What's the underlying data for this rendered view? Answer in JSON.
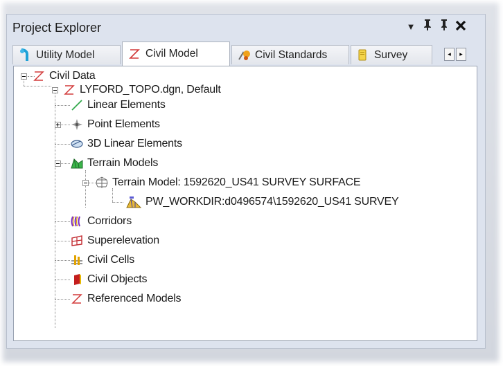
{
  "panel": {
    "title": "Project Explorer",
    "controls": {
      "dropdown": "▼",
      "pin": "ᵽ",
      "autohide": "ᵽ",
      "close": "✕"
    }
  },
  "tabs": [
    {
      "label": "Utility Model",
      "icon": "utility-model-icon",
      "active": false
    },
    {
      "label": "Civil Model",
      "icon": "civil-model-icon",
      "active": true
    },
    {
      "label": "Civil Standards",
      "icon": "civil-standards-icon",
      "active": false
    },
    {
      "label": "Survey",
      "icon": "survey-icon",
      "active": false
    }
  ],
  "tab_scroll": {
    "left": "◂",
    "right": "▸"
  },
  "tree": {
    "root": {
      "label": "Civil Data",
      "icon": "civil-data-icon"
    },
    "file": {
      "label": "LYFORD_TOPO.dgn, Default",
      "icon": "civil-data-icon"
    },
    "items": [
      {
        "label": "Linear Elements",
        "icon": "linear-elements-icon"
      },
      {
        "label": "Point Elements",
        "icon": "point-elements-icon"
      },
      {
        "label": "3D Linear Elements",
        "icon": "3d-linear-elements-icon"
      },
      {
        "label": "Terrain Models",
        "icon": "terrain-models-icon"
      },
      {
        "label": "Terrain Model: 1592620_US41 SURVEY SURFACE",
        "icon": "terrain-model-icon"
      },
      {
        "label": "PW_WORKDIR:d0496574\\1592620_US41 SURVEY",
        "icon": "survey-source-icon"
      },
      {
        "label": "Corridors",
        "icon": "corridors-icon"
      },
      {
        "label": "Superelevation",
        "icon": "superelevation-icon"
      },
      {
        "label": "Civil Cells",
        "icon": "civil-cells-icon"
      },
      {
        "label": "Civil Objects",
        "icon": "civil-objects-icon"
      },
      {
        "label": "Referenced Models",
        "icon": "referenced-models-icon"
      }
    ]
  },
  "colors": {
    "accent_red": "#d23a3a",
    "panel_bg": "#dde3ee"
  }
}
